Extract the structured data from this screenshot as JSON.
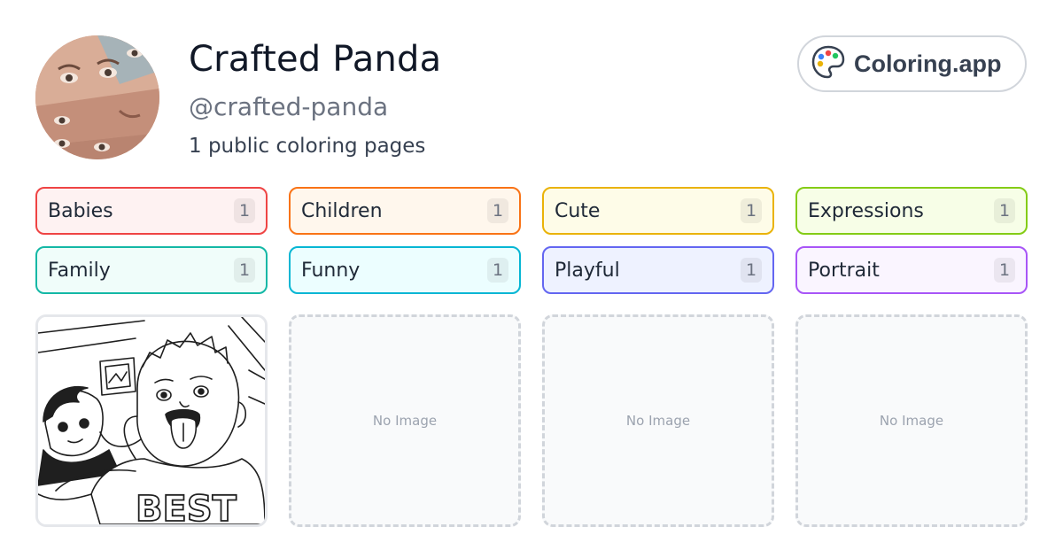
{
  "profile": {
    "name": "Crafted Panda",
    "handle": "@crafted-panda",
    "page_count_text": "1 public coloring pages"
  },
  "brand": {
    "label": "Coloring.app",
    "icon": "palette-icon"
  },
  "tags": [
    {
      "label": "Babies",
      "count": "1",
      "border": "#ef4444",
      "bg": "#fef2f2"
    },
    {
      "label": "Children",
      "count": "1",
      "border": "#f97316",
      "bg": "#fff7ed"
    },
    {
      "label": "Cute",
      "count": "1",
      "border": "#eab308",
      "bg": "#fefce8"
    },
    {
      "label": "Expressions",
      "count": "1",
      "border": "#84cc16",
      "bg": "#f7fee7"
    },
    {
      "label": "Family",
      "count": "1",
      "border": "#14b8a6",
      "bg": "#f0fdfa"
    },
    {
      "label": "Funny",
      "count": "1",
      "border": "#06b6d4",
      "bg": "#ecfeff"
    },
    {
      "label": "Playful",
      "count": "1",
      "border": "#6366f1",
      "bg": "#eef2ff"
    },
    {
      "label": "Portrait",
      "count": "1",
      "border": "#a855f7",
      "bg": "#faf5ff"
    }
  ],
  "cards": [
    {
      "type": "image",
      "text_on_art": "BEST"
    },
    {
      "type": "empty",
      "label": "No Image"
    },
    {
      "type": "empty",
      "label": "No Image"
    },
    {
      "type": "empty",
      "label": "No Image"
    }
  ]
}
